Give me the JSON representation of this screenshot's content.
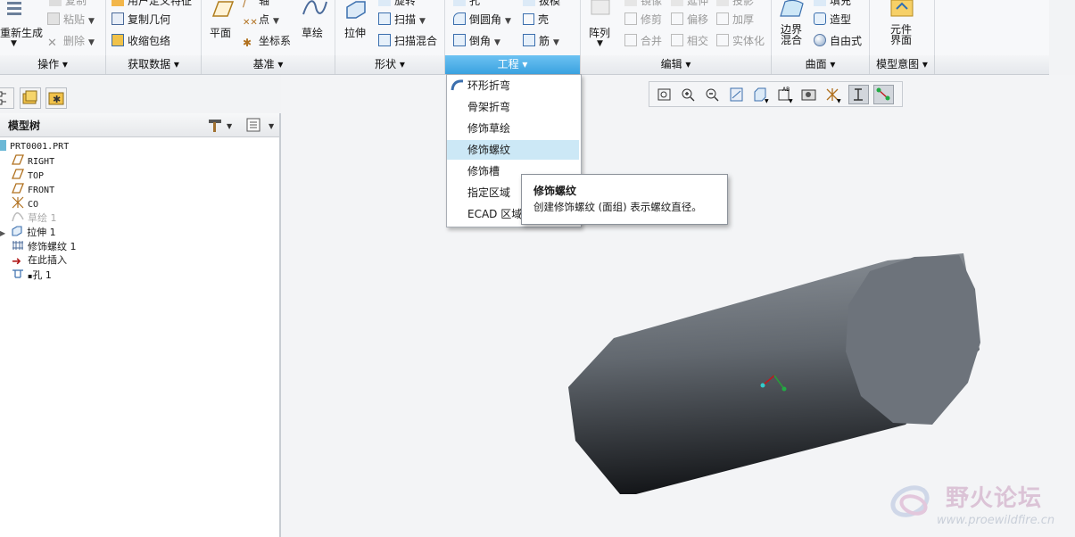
{
  "ribbon": {
    "ops": {
      "items": [
        "用户定义特征",
        "复制",
        "粘贴",
        "删除"
      ],
      "regenerate": "重新生成"
    },
    "getdata": {
      "items": [
        "用户定义特征",
        "复制几何",
        "收缩包络"
      ]
    },
    "datum": {
      "plane": "平面",
      "axis": "轴",
      "point": "点",
      "csys": "坐标系",
      "sketch": "草绘"
    },
    "shape": {
      "extrude": "拉伸",
      "revolve": "旋转",
      "sweep": "扫描",
      "blend": "扫描混合"
    },
    "eng": {
      "hole": "孔",
      "round": "倒圆角",
      "chamfer": "倒角",
      "draft": "拔模",
      "shell": "壳",
      "rib": "筋"
    },
    "edit": {
      "pattern": "阵列",
      "items": [
        "镜像",
        "修剪",
        "合并",
        "延伸",
        "偏移",
        "相交",
        "投影",
        "加厚",
        "实体化"
      ]
    },
    "surface": {
      "boundary": "边界\n混合",
      "items": [
        "填充",
        "造型",
        "自由式"
      ]
    },
    "model_intent": {
      "component": "元件\n界面"
    }
  },
  "groups": [
    "操作",
    "获取数据",
    "基准",
    "形状",
    "工程",
    "编辑",
    "曲面",
    "模型意图"
  ],
  "tree": {
    "title": "模型树",
    "items": [
      {
        "label": "PRT0001.PRT",
        "icon": "part-icon"
      },
      {
        "label": "RIGHT",
        "icon": "datum-plane-icon"
      },
      {
        "label": "TOP",
        "icon": "datum-plane-icon"
      },
      {
        "label": "FRONT",
        "icon": "datum-plane-icon"
      },
      {
        "label": "CO",
        "icon": "csys-icon"
      },
      {
        "label": "草绘 1",
        "icon": "sketch-icon"
      },
      {
        "label": "拉伸 1",
        "icon": "extrude-icon"
      },
      {
        "label": "修饰螺纹 1",
        "icon": "thread-icon"
      },
      {
        "label": "在此插入",
        "icon": "insert-arrow-icon"
      },
      {
        "label": "孔 1",
        "icon": "hole-icon"
      }
    ]
  },
  "menu": {
    "items": [
      "环形折弯",
      "骨架折弯",
      "修饰草绘",
      "修饰螺纹",
      "修饰槽",
      "指定区域",
      "ECAD 区域"
    ],
    "highlighted_index": 3
  },
  "tooltip": {
    "title": "修饰螺纹",
    "desc": "创建修饰螺纹 (面组) 表示螺纹直径。"
  },
  "watermark": {
    "text": "野火论坛",
    "url": "www.proewildfire.cn"
  },
  "colors": {
    "accent": "#3aa2e0",
    "menu_highlight": "#cce8f6",
    "cylinder": "#6e747c"
  }
}
